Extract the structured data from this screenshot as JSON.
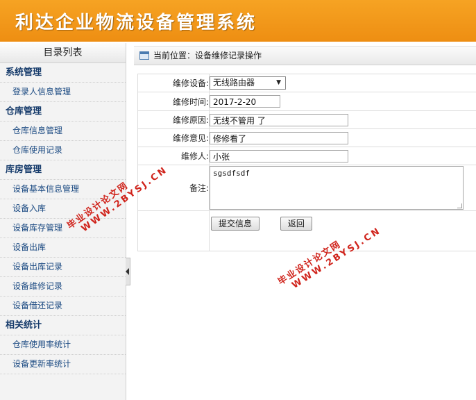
{
  "header": {
    "title": "利达企业物流设备管理系统"
  },
  "sidebar": {
    "title": "目录列表",
    "groups": [
      {
        "title": "系统管理",
        "items": [
          "登录人信息管理"
        ]
      },
      {
        "title": "仓库管理",
        "items": [
          "仓库信息管理",
          "仓库使用记录"
        ]
      },
      {
        "title": "库房管理",
        "items": [
          "设备基本信息管理",
          "设备入库",
          "设备库存管理",
          "设备出库",
          "设备出库记录",
          "设备维修记录",
          "设备借还记录"
        ]
      },
      {
        "title": "相关统计",
        "items": [
          "仓库使用率统计",
          "设备更新率统计"
        ]
      }
    ]
  },
  "breadcrumb": {
    "text": "当前位置：设备维修记录操作"
  },
  "form": {
    "device_label": "维修设备:",
    "device_value": "无线路由器",
    "time_label": "维修时间:",
    "time_value": "2017-2-20",
    "reason_label": "维修原因:",
    "reason_value": "无线不管用 了",
    "opinion_label": "维修意见:",
    "opinion_value": "修修看了",
    "person_label": "维修人:",
    "person_value": "小张",
    "remark_label": "备注:",
    "remark_value": "sgsdfsdf",
    "submit_label": "提交信息",
    "back_label": "返回"
  },
  "watermark": {
    "line1": "毕业设计论文网",
    "line2": "WWW.2BYSJ.CN"
  }
}
